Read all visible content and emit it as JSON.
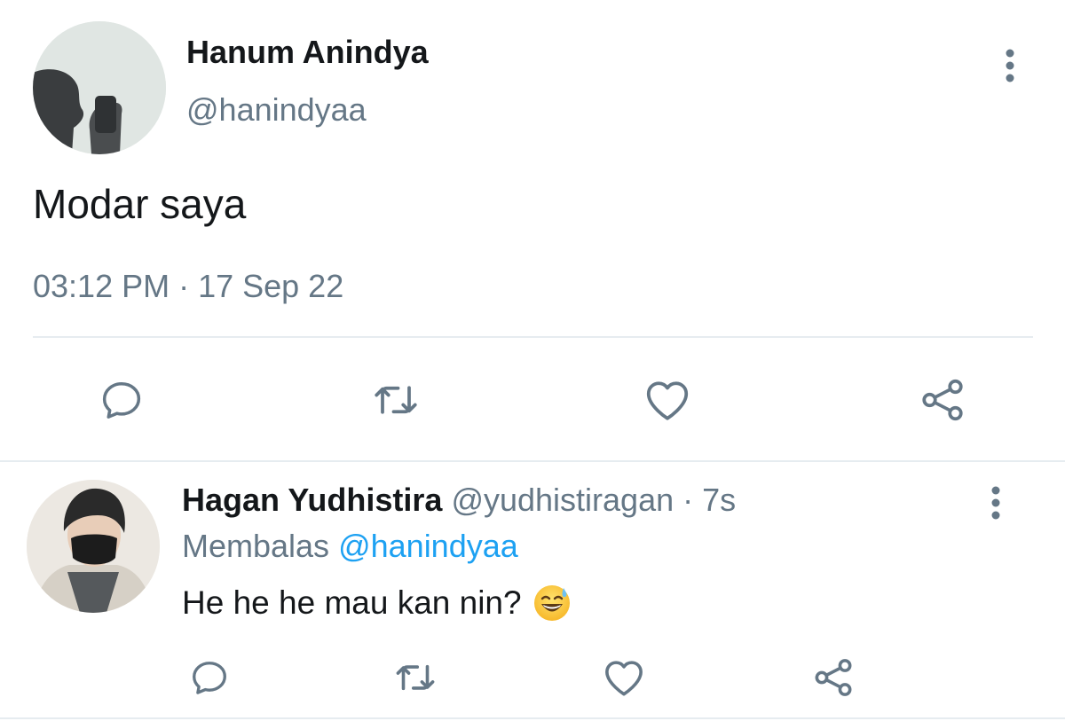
{
  "main_tweet": {
    "author_name": "Hanum Anindya",
    "author_handle": "@hanindyaa",
    "avatar_icon": "silhouette-selfie-avatar",
    "more_icon": "more-vertical-icon",
    "text": "Modar saya",
    "timestamp": "03:12 PM · 17 Sep 22",
    "actions": [
      {
        "icon": "reply-icon"
      },
      {
        "icon": "retweet-icon"
      },
      {
        "icon": "like-icon"
      },
      {
        "icon": "share-icon"
      }
    ]
  },
  "reply_tweet": {
    "author_name": "Hagan Yudhistira",
    "author_handle": "@yudhistiragan",
    "separator": " · ",
    "age": "7s",
    "avatar_icon": "masked-person-avatar",
    "more_icon": "more-vertical-icon",
    "reply_label": "Membalas",
    "reply_to_handle": "@hanindyaa",
    "text": "He he he mau kan nin?",
    "emoji": "grinning-sweat-emoji",
    "actions": [
      {
        "icon": "reply-icon"
      },
      {
        "icon": "retweet-icon"
      },
      {
        "icon": "like-icon"
      },
      {
        "icon": "share-icon"
      }
    ]
  },
  "colors": {
    "text_primary": "#14171a",
    "text_secondary": "#657786",
    "link": "#1da1f2",
    "divider": "#e6ecf0"
  }
}
